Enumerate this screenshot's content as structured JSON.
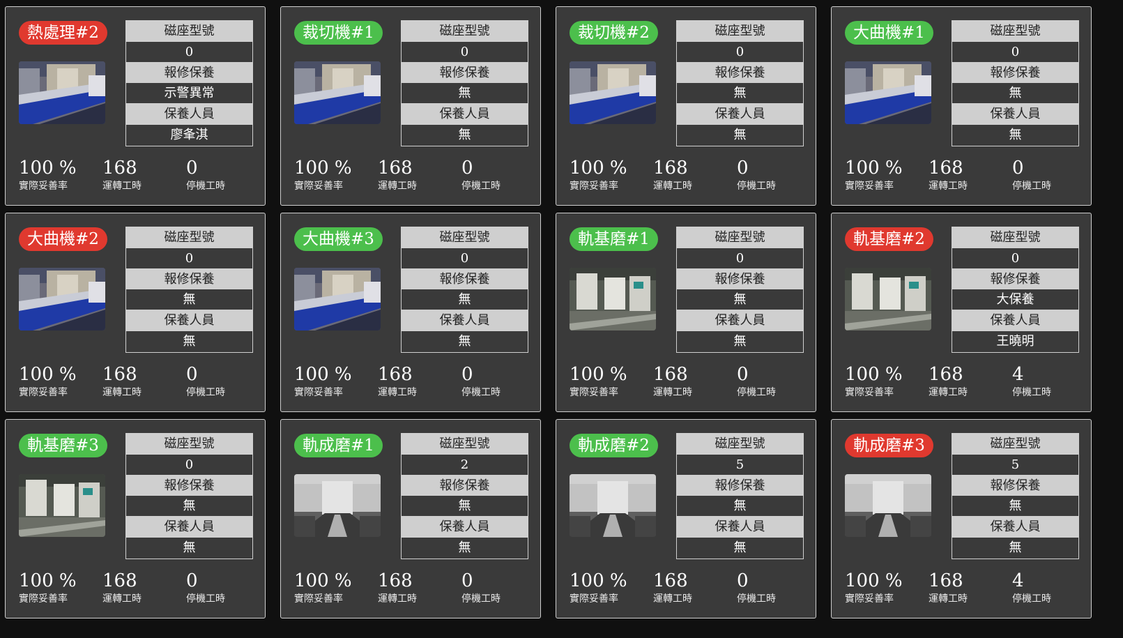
{
  "labels": {
    "model_label": "磁座型號",
    "repair_label": "報修保養",
    "staff_label": "保養人員",
    "availability_caption": "實際妥善率",
    "run_caption": "運轉工時",
    "down_caption": "停機工時"
  },
  "colors": {
    "alarm": "#e0392f",
    "normal": "#4cbf4c",
    "card_bg": "#3a3a3a",
    "page_bg": "#101010"
  },
  "machines": [
    {
      "name": "熱處理#2",
      "status": "red",
      "photo": "line",
      "model": "0",
      "repair": "示警異常",
      "staff": "廖夆淇",
      "availability": "100 %",
      "run_hours": "168",
      "down_hours": "0"
    },
    {
      "name": "裁切機#1",
      "status": "green",
      "photo": "line",
      "model": "0",
      "repair": "無",
      "staff": "無",
      "availability": "100 %",
      "run_hours": "168",
      "down_hours": "0"
    },
    {
      "name": "裁切機#2",
      "status": "green",
      "photo": "line",
      "model": "0",
      "repair": "無",
      "staff": "無",
      "availability": "100 %",
      "run_hours": "168",
      "down_hours": "0"
    },
    {
      "name": "大曲機#1",
      "status": "green",
      "photo": "line",
      "model": "0",
      "repair": "無",
      "staff": "無",
      "availability": "100 %",
      "run_hours": "168",
      "down_hours": "0"
    },
    {
      "name": "大曲機#2",
      "status": "red",
      "photo": "line",
      "model": "0",
      "repair": "無",
      "staff": "無",
      "availability": "100 %",
      "run_hours": "168",
      "down_hours": "0"
    },
    {
      "name": "大曲機#3",
      "status": "green",
      "photo": "line",
      "model": "0",
      "repair": "無",
      "staff": "無",
      "availability": "100 %",
      "run_hours": "168",
      "down_hours": "0"
    },
    {
      "name": "軌基磨#1",
      "status": "green",
      "photo": "grinder",
      "model": "0",
      "repair": "無",
      "staff": "無",
      "availability": "100 %",
      "run_hours": "168",
      "down_hours": "0"
    },
    {
      "name": "軌基磨#2",
      "status": "red",
      "photo": "grinder",
      "model": "0",
      "repair": "大保養",
      "staff": "王曉明",
      "availability": "100 %",
      "run_hours": "168",
      "down_hours": "4"
    },
    {
      "name": "軌基磨#3",
      "status": "green",
      "photo": "grinder",
      "model": "0",
      "repair": "無",
      "staff": "無",
      "availability": "100 %",
      "run_hours": "168",
      "down_hours": "0"
    },
    {
      "name": "軌成磨#1",
      "status": "green",
      "photo": "former",
      "model": "2",
      "repair": "無",
      "staff": "無",
      "availability": "100 %",
      "run_hours": "168",
      "down_hours": "0"
    },
    {
      "name": "軌成磨#2",
      "status": "green",
      "photo": "former",
      "model": "5",
      "repair": "無",
      "staff": "無",
      "availability": "100 %",
      "run_hours": "168",
      "down_hours": "0"
    },
    {
      "name": "軌成磨#3",
      "status": "red",
      "photo": "former",
      "model": "5",
      "repair": "無",
      "staff": "無",
      "availability": "100 %",
      "run_hours": "168",
      "down_hours": "4"
    }
  ]
}
